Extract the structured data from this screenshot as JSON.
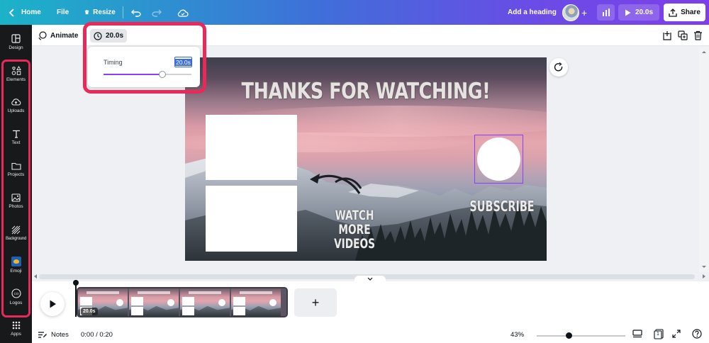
{
  "topbar": {
    "home_label": "Home",
    "file_label": "File",
    "resize_label": "Resize",
    "heading_label": "Add a heading",
    "add_collaborator": "+",
    "play_duration": "20.0s",
    "share_label": "Share"
  },
  "sidebar": {
    "items": [
      {
        "label": "Design",
        "icon": "layout-icon"
      },
      {
        "label": "Elements",
        "icon": "shapes-icon"
      },
      {
        "label": "Uploads",
        "icon": "cloud-upload-icon"
      },
      {
        "label": "Text",
        "icon": "text-icon"
      },
      {
        "label": "Projects",
        "icon": "folder-icon"
      },
      {
        "label": "Photos",
        "icon": "image-icon"
      },
      {
        "label": "Background",
        "icon": "background-pattern-icon"
      },
      {
        "label": "Emoji",
        "icon": "emoji-icon"
      },
      {
        "label": "Logos",
        "icon": "logo-icon"
      },
      {
        "label": "Apps",
        "icon": "apps-grid-icon"
      }
    ]
  },
  "context_toolbar": {
    "animate_label": "Animate",
    "timing_value": "20.0s"
  },
  "timing_popup": {
    "label": "Timing",
    "value": "20.0s",
    "slider_fraction": 0.67
  },
  "canvas": {
    "title": "THANKS FOR WATCHING!",
    "watch_more": "WATCH MORE",
    "videos": "VIDEOS",
    "subscribe": "SUBSCRIBE"
  },
  "timeline": {
    "clip_duration": "20.0s",
    "add_page": "+"
  },
  "bottombar": {
    "notes_label": "Notes",
    "time_readout": "0:00 / 0:20",
    "zoom_label": "43%",
    "zoom_fraction": 0.36,
    "page_count": "1"
  },
  "colors": {
    "accent": "#8b3dff",
    "highlight": "#e8295a",
    "rail": "#18191b"
  }
}
